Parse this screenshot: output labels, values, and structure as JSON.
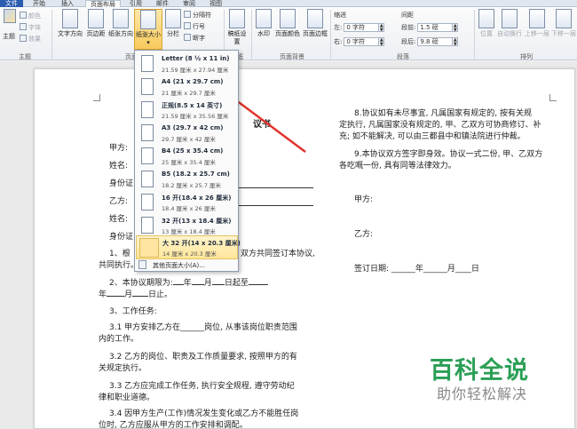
{
  "tabs": {
    "file": "文件",
    "start": "开始",
    "insert": "插入",
    "layout": "页面布局",
    "references": "引用",
    "mailings": "邮件",
    "review": "审阅",
    "view": "视图"
  },
  "ribbon": {
    "theme_group": {
      "theme_label": "主题",
      "colors": "颜色",
      "fonts": "字体",
      "effects": "效果",
      "group_label": "主题"
    },
    "page_setup": {
      "text_direction": "文字方向",
      "margins": "页边距",
      "orientation": "纸张方向",
      "size": "纸张大小",
      "columns": "分栏",
      "breaks": "分隔符",
      "line_numbers": "行号",
      "hyphenation": "断字",
      "group_label": "页面设置"
    },
    "manuscript": {
      "label": "稿纸设置",
      "group_label": "稿纸"
    },
    "page_background": {
      "watermark": "水印",
      "page_color": "页面颜色",
      "page_borders": "页面边框",
      "group_label": "页面背景"
    },
    "paragraph": {
      "indent_label": "缩进",
      "spacing_label": "间距",
      "left_label": "左:",
      "left_value": "0 字符",
      "right_label": "右:",
      "right_value": "0 字符",
      "before_label": "段前:",
      "before_value": "1.5 磅",
      "after_label": "段后:",
      "after_value": "9.8 磅",
      "group_label": "段落"
    },
    "arrange": {
      "position": "位置",
      "wrap_text": "自动换行",
      "bring_forward": "上移一层",
      "send_backward": "下移一层",
      "group_label": "排列"
    }
  },
  "paper_size_menu": {
    "items": [
      {
        "name": "Letter (8 ½ x 11 in)",
        "size": "21.59 厘米 x 27.94 厘米"
      },
      {
        "name": "A4 (21 x 29.7 cm)",
        "size": "21 厘米 x 29.7 厘米"
      },
      {
        "name": "正规(8.5 x 14 英寸)",
        "size": "21.59 厘米 x 35.56 厘米"
      },
      {
        "name": "A3 (29.7 x 42 cm)",
        "size": "29.7 厘米 x 42 厘米"
      },
      {
        "name": "B4 (25 x 35.4 cm)",
        "size": "25 厘米 x 35.4 厘米"
      },
      {
        "name": "B5 (18.2 x 25.7 cm)",
        "size": "18.2 厘米 x 25.7 厘米"
      },
      {
        "name": "16 开(18.4 x 26 厘米)",
        "size": "18.4 厘米 x 26 厘米"
      },
      {
        "name": "32 开(13 x 18.4 厘米)",
        "size": "13 厘米 x 18.4 厘米"
      },
      {
        "name": "大 32 开(14 x 20.3 厘米)",
        "size": "14 厘米 x 20.3 厘米"
      }
    ],
    "more_sizes": "其他页面大小(A)..."
  },
  "document": {
    "title_fragment": "议书",
    "party_a": "甲方:",
    "name1": "姓名:",
    "id1": "身份证",
    "party_b": "乙方:",
    "name2": "姓名:",
    "id2": "身份证",
    "clause1_start": "1、根",
    "clause1_end": "双方共同签订本协议,",
    "clause1_line2": "共同执行。",
    "clause2_a": "2、本协议期限为",
    "clause2_b": "年",
    "clause2_c": "月",
    "clause2_d": "日起至",
    "clause2_e": "年",
    "clause2_f": "月",
    "clause2_g": "日止。",
    "clause3": "3、工作任务:",
    "c31": "3.1 甲方安排乙方在______岗位, 从事该岗位职责范围",
    "c31b": "内的工作。",
    "c32": "3.2 乙方的岗位、职责及工作质量要求, 按照甲方的有",
    "c32b": "关规定执行。",
    "c33": "3.3 乙方应完成工作任务, 执行安全规程, 遵守劳动纪",
    "c33b": "律和职业道德。",
    "c34": "3.4 因甲方生产(工作)情况发生变化或乙方不能胜任岗",
    "c34b": "位时, 乙方应服从甲方的工作安排和调配。",
    "r8": "8.协议如有未尽事宜, 凡属国家有规定的, 按有关规",
    "r8b": "定执行, 凡属国家没有规定的, 甲、乙双方可协商修订、补",
    "r8c": "充; 如不能解决, 可以由三都县中和镇法院进行仲裁。",
    "r9": "9.本协议双方签字即身效。协议一式二份, 甲、乙双方",
    "r9b": "各吃嘅一份, 具有同等法律效力。",
    "sig_a": "甲方:",
    "sig_b": "乙方:",
    "sign_date": "签订日期: ______年______月____日"
  },
  "watermark": {
    "title": "百科全说",
    "subtitle": "助你轻松解决"
  }
}
